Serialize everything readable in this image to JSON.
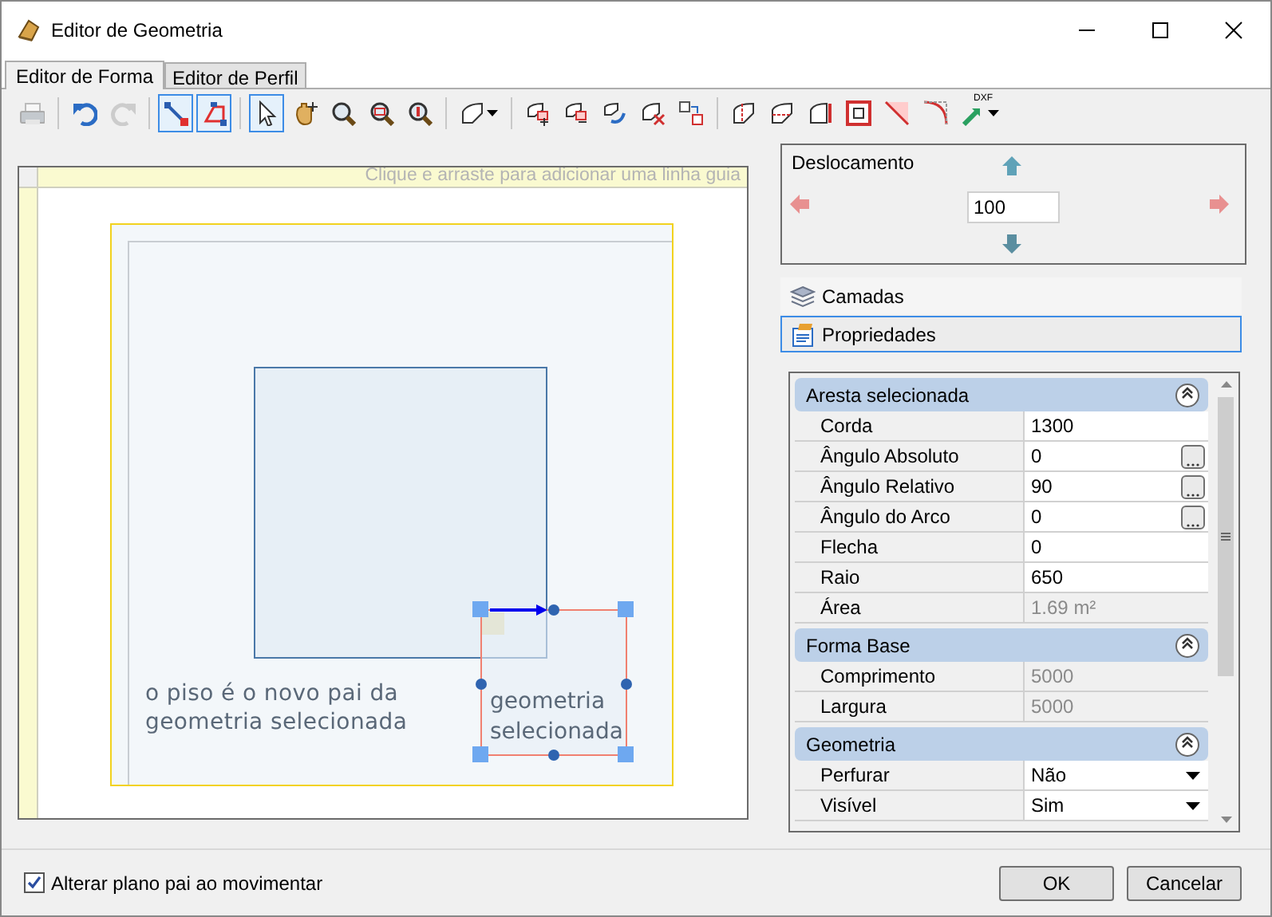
{
  "window": {
    "title": "Editor de Geometria"
  },
  "tabs": [
    {
      "label": "Editor de Forma",
      "selected": true
    },
    {
      "label": "Editor de Perfil",
      "selected": false
    }
  ],
  "toolbar": [
    {
      "kind": "button",
      "selected": false,
      "disabled": true
    },
    {
      "kind": "separator"
    },
    {
      "kind": "button",
      "selected": false,
      "disabled": false
    },
    {
      "kind": "button",
      "selected": false,
      "disabled": true
    },
    {
      "kind": "separator"
    },
    {
      "kind": "button",
      "selected": true,
      "disabled": false
    },
    {
      "kind": "button",
      "selected": true,
      "disabled": false
    },
    {
      "kind": "separator"
    },
    {
      "kind": "button",
      "selected": true,
      "disabled": false
    },
    {
      "kind": "button",
      "selected": false,
      "disabled": false
    },
    {
      "kind": "button",
      "selected": false,
      "disabled": false
    },
    {
      "kind": "button",
      "selected": false,
      "disabled": false
    },
    {
      "kind": "button",
      "selected": false,
      "disabled": false
    },
    {
      "kind": "separator"
    },
    {
      "kind": "dropdown",
      "selected": false,
      "disabled": false
    },
    {
      "kind": "separator"
    },
    {
      "kind": "button",
      "selected": false,
      "disabled": false
    },
    {
      "kind": "button",
      "selected": false,
      "disabled": false
    },
    {
      "kind": "button",
      "selected": false,
      "disabled": false
    },
    {
      "kind": "button",
      "selected": false,
      "disabled": false
    },
    {
      "kind": "button",
      "selected": false,
      "disabled": false
    },
    {
      "kind": "separator"
    },
    {
      "kind": "button",
      "selected": false,
      "disabled": false
    },
    {
      "kind": "button",
      "selected": false,
      "disabled": false
    },
    {
      "kind": "button",
      "selected": false,
      "disabled": false
    },
    {
      "kind": "button",
      "selected": false,
      "disabled": false
    },
    {
      "kind": "button",
      "selected": false,
      "disabled": false
    },
    {
      "kind": "button",
      "selected": false,
      "disabled": false
    },
    {
      "kind": "dropdown",
      "selected": false,
      "disabled": false,
      "label": "DXF"
    }
  ],
  "canvas": {
    "hint": "Clique e arraste para adicionar uma linha guia",
    "labels": [
      {
        "text": "o piso é o novo pai da geometria selecionada"
      },
      {
        "text": "geometria selecionada"
      }
    ]
  },
  "offset_panel": {
    "title": "Deslocamento",
    "value": "100"
  },
  "panels": [
    {
      "label": "Camadas",
      "selected": false
    },
    {
      "label": "Propriedades",
      "selected": true
    }
  ],
  "properties": [
    {
      "title": "Aresta selecionada",
      "expanded": true,
      "rows": [
        {
          "label": "Corda",
          "value": "1300",
          "kind": "text"
        },
        {
          "label": "Ângulo Absoluto",
          "value": "0",
          "kind": "ellipsis"
        },
        {
          "label": "Ângulo Relativo",
          "value": "90",
          "kind": "ellipsis"
        },
        {
          "label": "Ângulo do Arco",
          "value": "0",
          "kind": "ellipsis"
        },
        {
          "label": "Flecha",
          "value": "0",
          "kind": "text"
        },
        {
          "label": "Raio",
          "value": "650",
          "kind": "text"
        },
        {
          "label": "Área",
          "value": "1.69 m²",
          "kind": "readonly"
        }
      ]
    },
    {
      "title": "Forma Base",
      "expanded": true,
      "rows": [
        {
          "label": "Comprimento",
          "value": "5000",
          "kind": "readonly"
        },
        {
          "label": "Largura",
          "value": "5000",
          "kind": "readonly"
        }
      ]
    },
    {
      "title": "Geometria",
      "expanded": true,
      "rows": [
        {
          "label": "Perfurar",
          "value": "Não",
          "kind": "dropdown"
        },
        {
          "label": "Visível",
          "value": "Sim",
          "kind": "dropdown"
        }
      ]
    }
  ],
  "footer": {
    "checkbox": {
      "label": "Alterar plano pai ao movimentar",
      "checked": true
    },
    "buttons": [
      "OK",
      "Cancelar"
    ]
  }
}
